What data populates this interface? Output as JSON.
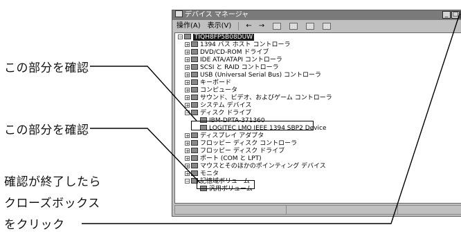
{
  "callouts": {
    "check1": "この部分を確認",
    "check2": "この部分を確認",
    "close_line1": "確認が終了したら",
    "close_line2": "クローズボックス",
    "close_line3": "をクリック"
  },
  "window": {
    "title": "デバイス マネージャ",
    "menu": [
      "操作(A)",
      "表示(V)"
    ]
  },
  "tree": {
    "root": "TIQH8FP5B08DUW",
    "items": [
      "1394 バス ホスト コントローラ",
      "DVD/CD-ROM ドライブ",
      "IDE ATA/ATAPI コントローラ",
      "SCSI と RAID コントローラ",
      "USB (Universal Serial Bus) コントローラ",
      "キーボード",
      "コンピュータ",
      "サウンド、ビデオ、およびゲーム コントローラ",
      "システム デバイス",
      "ディスク ドライブ",
      "IBM-DPTA-371360",
      "LOGITEC LMO IEEE 1394 SBP2 Device",
      "ディスプレイ アダプタ",
      "フロッピー ディスク コントローラ",
      "フロッピー ディスク ドライブ",
      "ポート (COM と LPT)",
      "マウスとそのほかのポインティング デバイス",
      "モニタ",
      "記憶域ボリューム",
      "汎用ボリューム"
    ]
  }
}
